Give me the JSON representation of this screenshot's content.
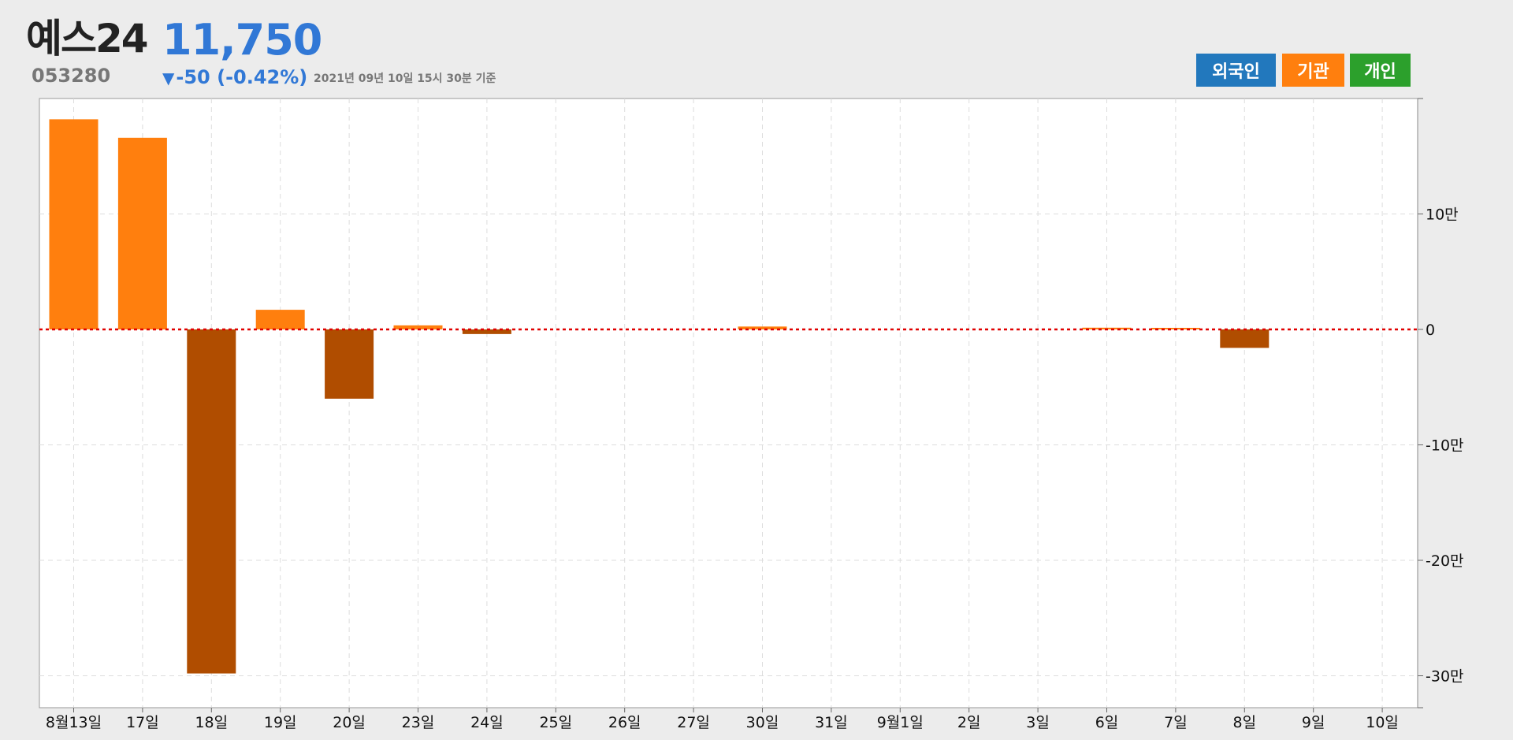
{
  "header": {
    "stock_name": "예스24",
    "stock_code": "053280",
    "price": "11,750",
    "change_arrow": "▼",
    "change_text": "-50 (-0.42%)",
    "timestamp": "2021년 09년 10일 15시 30분 기준"
  },
  "legend": {
    "items": [
      {
        "label": "외국인",
        "color": "#2278bd"
      },
      {
        "label": "기관",
        "color": "#ff7f0e"
      },
      {
        "label": "개인",
        "color": "#2ca02c"
      }
    ]
  },
  "colors": {
    "institution_positive": "#ff7f0e",
    "institution_negative": "#b04d00",
    "zero_line": "#e00000",
    "grid": "#dddddd",
    "plot_background": "#ffffff"
  },
  "chart_data": {
    "type": "bar",
    "categories": [
      "8월13일",
      "17일",
      "18일",
      "19일",
      "20일",
      "23일",
      "24일",
      "25일",
      "26일",
      "27일",
      "30일",
      "31일",
      "9월1일",
      "2일",
      "3일",
      "6일",
      "7일",
      "8일",
      "9일",
      "10일"
    ],
    "series": [
      {
        "name": "기관",
        "values": [
          182000,
          166000,
          -298000,
          17000,
          -60000,
          3500,
          -4000,
          0,
          0,
          0,
          2500,
          0,
          0,
          0,
          0,
          1500,
          1000,
          -16000,
          0,
          0
        ]
      }
    ],
    "y_ticks": [
      100000,
      0,
      -100000,
      -200000,
      -300000
    ],
    "y_tick_labels": [
      "10만",
      "0",
      "-10만",
      "-20만",
      "-30만"
    ],
    "ylim": [
      -326000,
      200000
    ],
    "grid": true,
    "zero_line": "dotted-red",
    "y_axis_position": "right"
  }
}
